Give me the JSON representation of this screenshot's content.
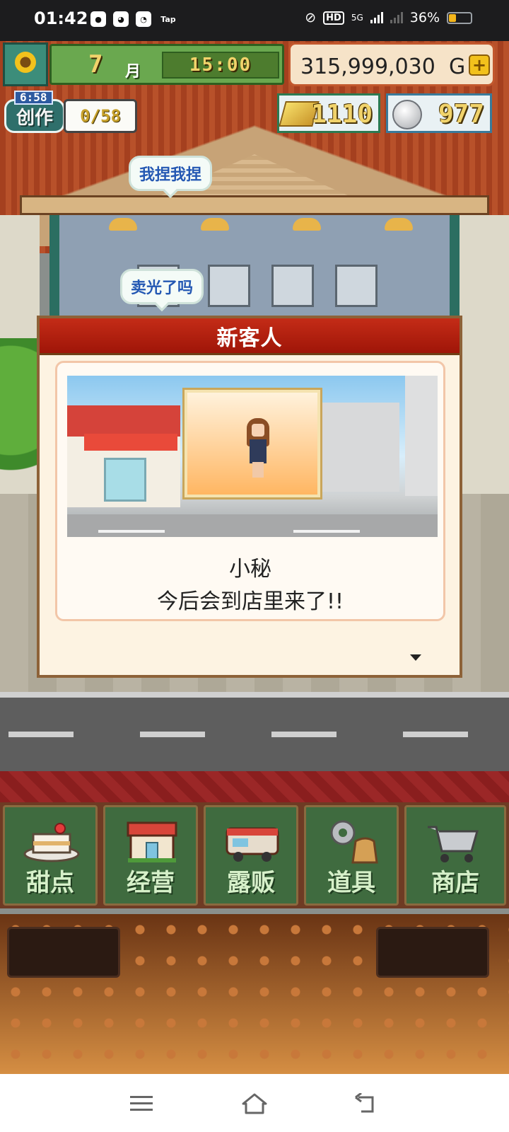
{
  "status_bar": {
    "time": "01:42",
    "network": "5G",
    "hd": "HD",
    "battery": "36%",
    "left_icons": [
      "app-icon-1",
      "cat-icon",
      "chat-icon",
      "tap-icon"
    ],
    "tap_label": "Tap"
  },
  "hud": {
    "month_num": "7",
    "month_unit": "月",
    "clock": "15:00",
    "money": "315,999,030",
    "money_unit": "G",
    "plus": "+",
    "create_timer": "6:58",
    "create_label": "创作",
    "create_count": "0/58",
    "gold": "1110",
    "silver": "977"
  },
  "bubbles": {
    "top": "我捏我捏",
    "shop": "卖光了吗"
  },
  "dialog": {
    "title": "新客人",
    "character_name": "小秘",
    "message": "今后会到店里来了!!"
  },
  "menu": [
    {
      "label": "甜点",
      "icon": "cake-icon"
    },
    {
      "label": "经营",
      "icon": "shop-icon"
    },
    {
      "label": "露贩",
      "icon": "food-truck-icon"
    },
    {
      "label": "道具",
      "icon": "gear-bag-icon"
    },
    {
      "label": "商店",
      "icon": "cart-icon"
    }
  ],
  "colors": {
    "dialog_header": "#b3210f",
    "menu_green": "#3f6b3f",
    "money_border": "#c2582d"
  }
}
